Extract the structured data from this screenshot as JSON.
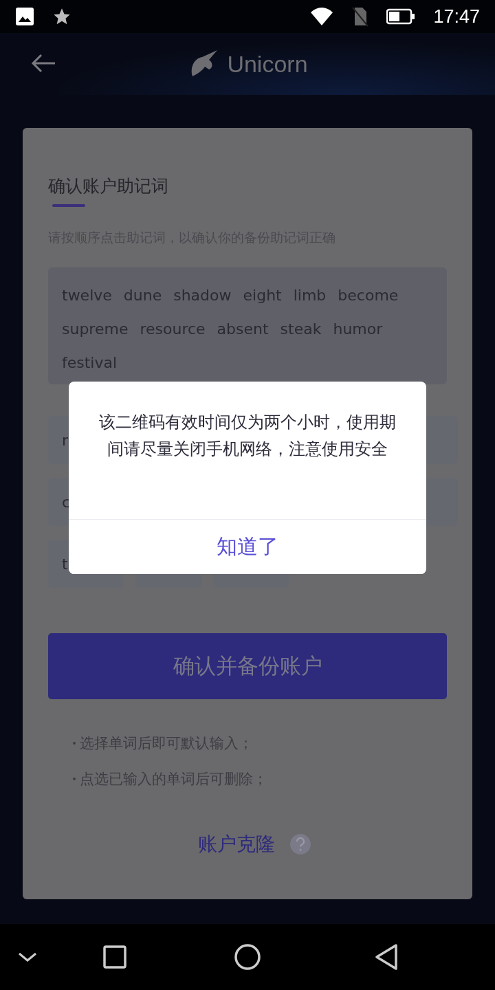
{
  "status_bar": {
    "time": "17:47"
  },
  "header": {
    "title": "Unicorn"
  },
  "card": {
    "title": "确认账户助记词",
    "subtitle": "请按顺序点击助记词，以确认你的备份助记词正确",
    "mnemonic": [
      "twelve",
      "dune",
      "shadow",
      "eight",
      "limb",
      "become",
      "supreme",
      "resource",
      "absent",
      "steak",
      "humor",
      "festival"
    ],
    "chip_rows": [
      "r",
      "c",
      "t"
    ],
    "confirm_button": "确认并备份账户",
    "notes": [
      "选择单词后即可默认输入；",
      "点选已输入的单词后可删除；"
    ],
    "clone_link": "账户克隆"
  },
  "dialog": {
    "message": "该二维码有效时间仅为两个小时，使用期间请尽量关闭手机网络，注意使用安全",
    "button": "知道了"
  }
}
